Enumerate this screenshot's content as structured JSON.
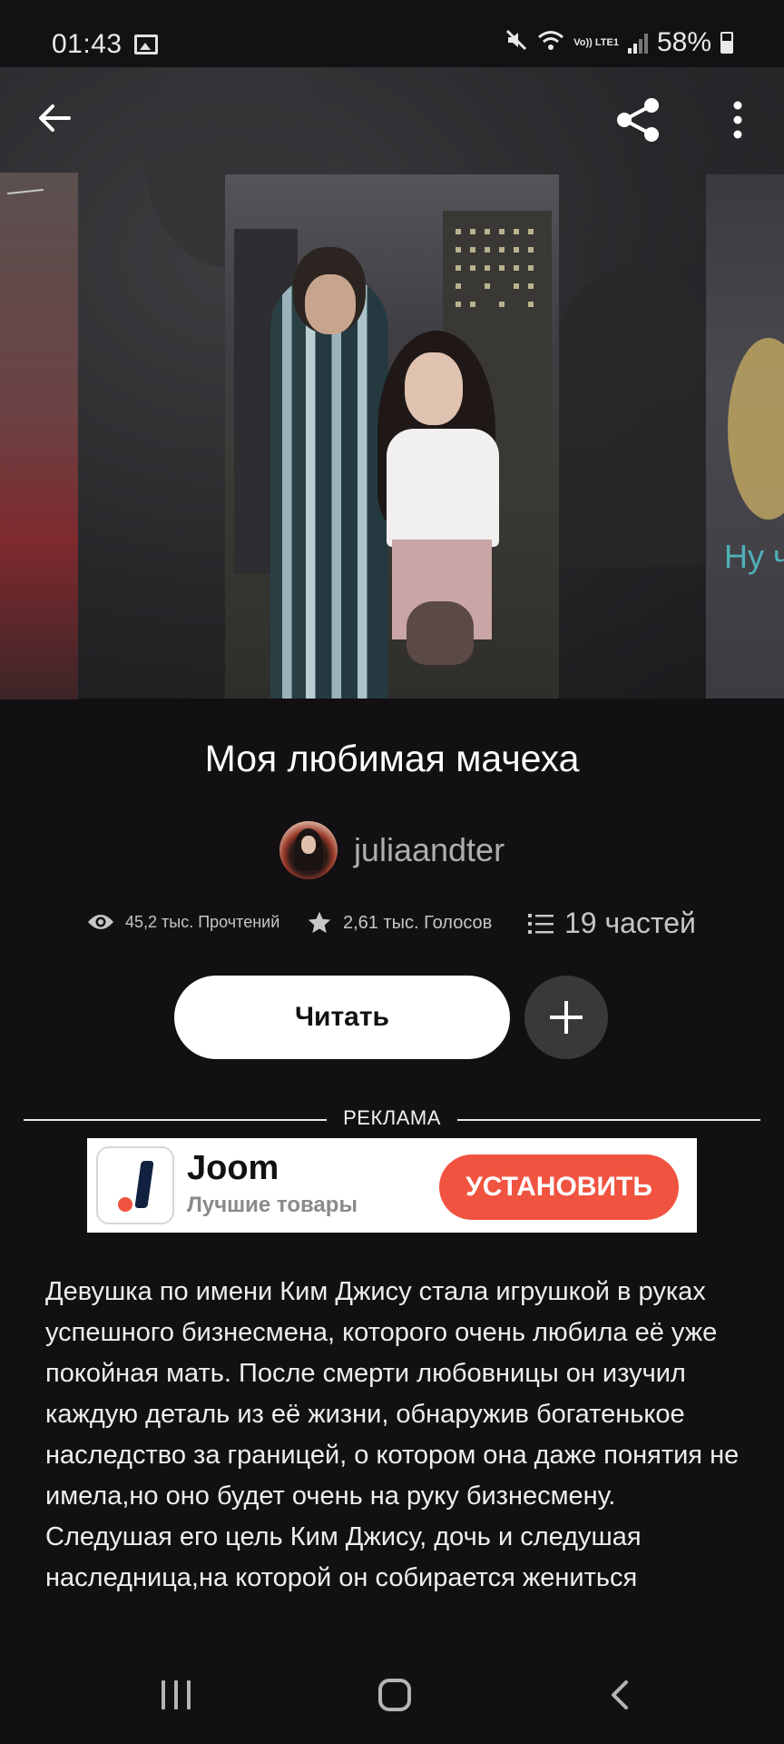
{
  "status_bar": {
    "time": "01:43",
    "battery": "58%",
    "network_label": "Vo)) LTE1"
  },
  "icons": {
    "back": "arrow-left-icon",
    "share": "share-icon",
    "more": "more-vertical-icon",
    "views": "eye-icon",
    "votes": "star-icon",
    "parts": "list-icon",
    "add": "plus-icon"
  },
  "cover_carousel": {
    "right_cover_text": "Ну ч"
  },
  "story": {
    "title": "Моя любимая мачеха",
    "author": "juliaandter",
    "reads": "45,2 тыс. Прочтений",
    "votes": "2,61 тыс. Голосов",
    "parts": "19 частей"
  },
  "actions": {
    "read_label": "Читать"
  },
  "ad": {
    "section_label": "РЕКЛАМА",
    "brand": "Joom",
    "tagline": "Лучшие товары",
    "cta": "УСТАНОВИТЬ",
    "cta_color": "#F0533F"
  },
  "description": {
    "paragraph1": "Девушка по имени Ким Джису стала игрушкой в руках успешного бизнесмена, которого очень любила её уже покойная мать. После смерти любовницы он изучил каждую деталь из её жизни, обнаружив богатенькое наследство за границей, о котором она даже понятия не имела,но оно будет очень на руку бизнесмену.",
    "paragraph2": "Следушая его цель Ким Джису, дочь и следушая наследница,на которой он собирается жениться"
  },
  "colors": {
    "background": "#121012",
    "primary_button": "#FFFFFF",
    "secondary_button": "#3A383B"
  }
}
